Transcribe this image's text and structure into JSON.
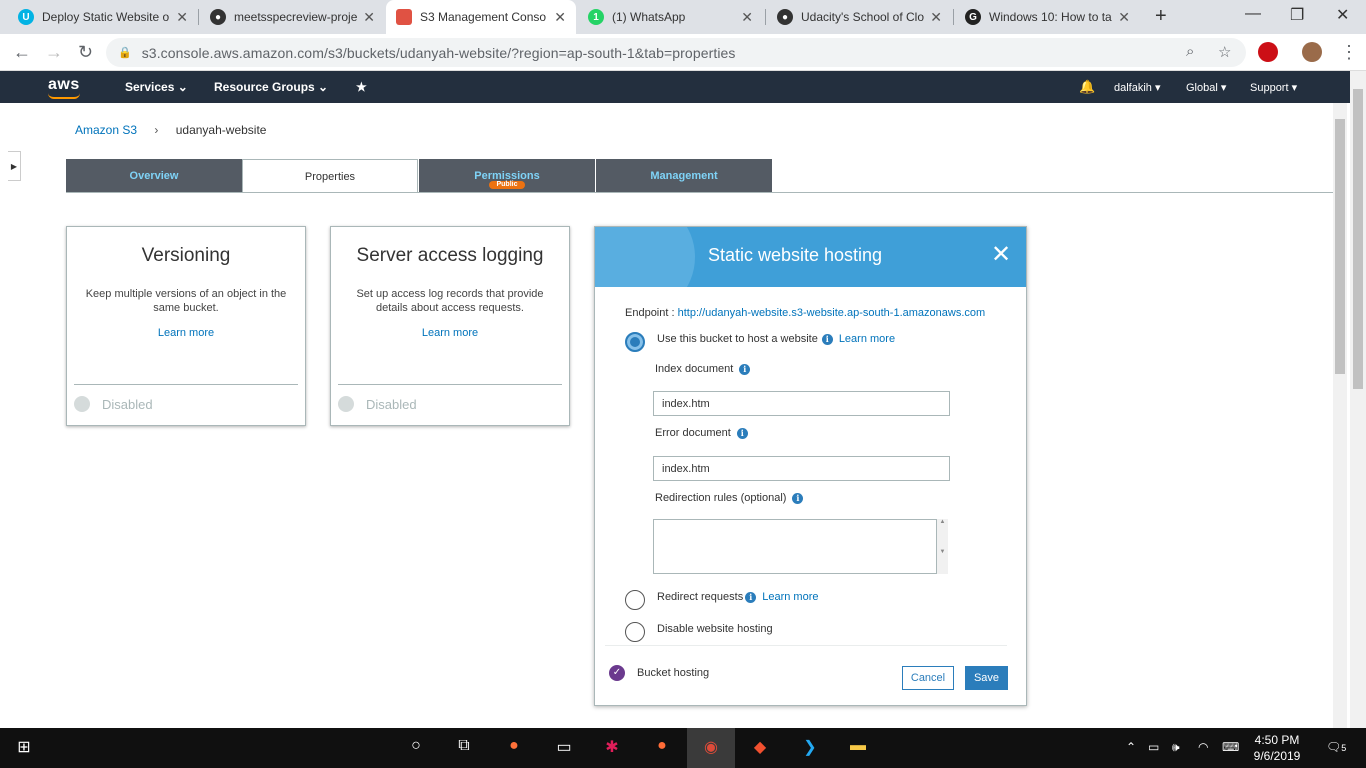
{
  "browser": {
    "tabs": [
      {
        "title": "Deploy Static Website o",
        "favicon": "udacity-icon",
        "color": "#02b3e4"
      },
      {
        "title": "meetsspecreview-proje",
        "favicon": "github-icon",
        "color": "#333333"
      },
      {
        "title": "S3 Management Conso",
        "favicon": "aws-s3-icon",
        "color": "#e05243"
      },
      {
        "title": "(1) WhatsApp",
        "favicon": "whatsapp-icon",
        "color": "#25d366"
      },
      {
        "title": "Udacity's School of Clo",
        "favicon": "github-icon",
        "color": "#333333"
      },
      {
        "title": "Windows 10: How to ta",
        "favicon": "g-icon",
        "color": "#222222"
      }
    ],
    "whatsapp_badge": "1",
    "url": "s3.console.aws.amazon.com/s3/buckets/udanyah-website/?region=ap-south-1&tab=properties"
  },
  "aws_header": {
    "logo": "aws",
    "services": "Services",
    "resource_groups": "Resource Groups",
    "user": "dalfakih",
    "region": "Global",
    "support": "Support"
  },
  "breadcrumb": {
    "root": "Amazon S3",
    "current": "udanyah-website"
  },
  "tabs": [
    {
      "label": "Overview"
    },
    {
      "label": "Properties"
    },
    {
      "label": "Permissions",
      "badge": "Public"
    },
    {
      "label": "Management"
    }
  ],
  "cards": [
    {
      "title": "Versioning",
      "description": "Keep multiple versions of an object in the same bucket.",
      "learn_more": "Learn more",
      "status": "Disabled"
    },
    {
      "title": "Server access logging",
      "description": "Set up access log records that provide details about access requests.",
      "learn_more": "Learn more",
      "status": "Disabled"
    }
  ],
  "modal": {
    "title": "Static website hosting",
    "endpoint_label": "Endpoint :",
    "endpoint_url": "http://udanyah-website.s3-website.ap-south-1.amazonaws.com",
    "option_host": "Use this bucket to host a website",
    "learn_more": "Learn more",
    "index_label": "Index document",
    "index_value": "index.htm",
    "error_label": "Error document",
    "error_value": "index.htm",
    "redirection_label": "Redirection rules (optional)",
    "option_redirect": "Redirect requests",
    "option_disable": "Disable website hosting",
    "bucket_hosting": "Bucket hosting",
    "cancel": "Cancel",
    "save": "Save"
  },
  "taskbar": {
    "time": "4:50 PM",
    "date": "9/6/2019",
    "notifications": "5"
  }
}
